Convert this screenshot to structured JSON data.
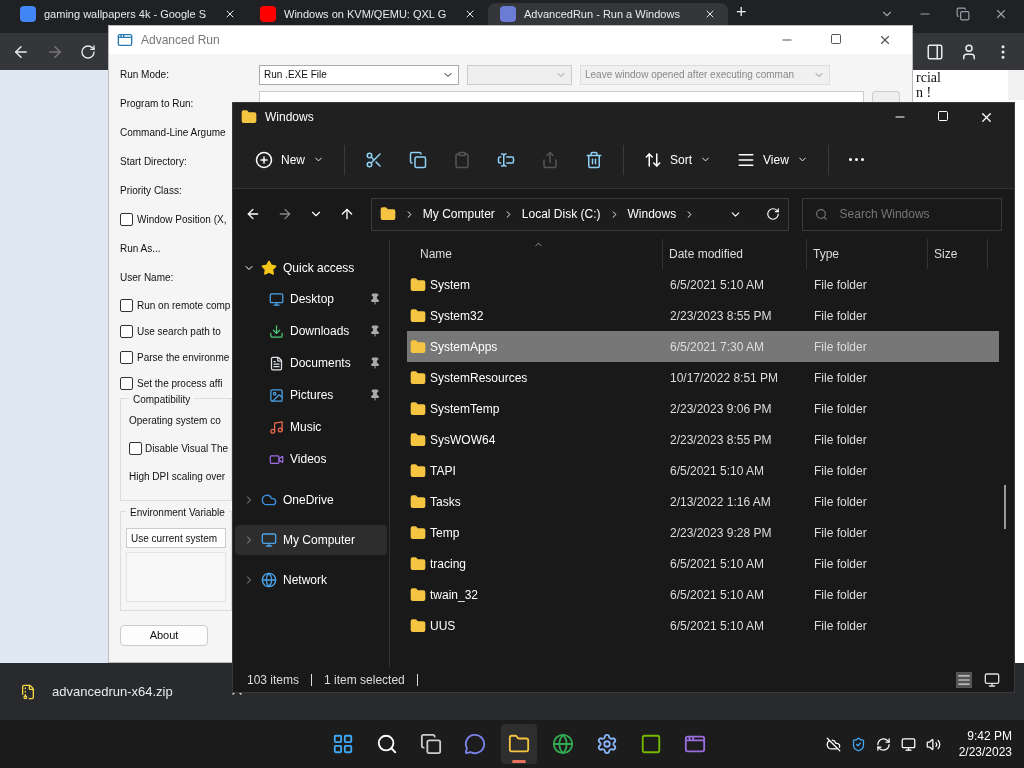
{
  "browser": {
    "tabs": [
      {
        "title": "gaming wallpapers 4k - Google S",
        "selected": false
      },
      {
        "title": "Windows on KVM/QEMU: QXL G",
        "selected": false
      },
      {
        "title": "AdvancedRun - Run a Windows",
        "selected": true
      }
    ],
    "new_tab": "+",
    "page_text": [
      "rcial",
      "n !"
    ]
  },
  "advanced_run": {
    "title": "Advanced Run",
    "run_mode": "Run .EXE File",
    "window_option": "Leave window opened after executing comman",
    "rows": [
      {
        "kind": "label",
        "text": "Run Mode:"
      },
      {
        "kind": "label",
        "text": "Program to Run:"
      },
      {
        "kind": "label",
        "text": "Command-Line Argume"
      },
      {
        "kind": "label",
        "text": "Start Directory:"
      },
      {
        "kind": "label",
        "text": "Priority Class:"
      },
      {
        "kind": "checkbox",
        "text": "Window Position (X,",
        "checked": false
      },
      {
        "kind": "label",
        "text": "Run As..."
      },
      {
        "kind": "label",
        "text": "User Name:"
      },
      {
        "kind": "checkbox",
        "text": "Run on remote comp",
        "checked": false
      },
      {
        "kind": "checkbox",
        "text": "Use search path to",
        "checked": false
      },
      {
        "kind": "checkbox",
        "text": "Parse the environme",
        "checked": false
      },
      {
        "kind": "checkbox",
        "text": "Set the process affi",
        "checked": false
      }
    ],
    "compatibility": {
      "title": "Compatibility",
      "os_label": "Operating system co",
      "checkbox": {
        "text": "Disable Visual The",
        "checked": false
      },
      "dpi_label": "High DPI scaling over"
    },
    "environment": {
      "title": "Environment Variable",
      "value": "Use current system"
    },
    "about_button": "About"
  },
  "downloads": {
    "file": "advancedrun-x64.zip"
  },
  "explorer": {
    "title": "Windows",
    "toolbar": [
      {
        "kind": "button",
        "label": "New",
        "caret": true,
        "disabled": false
      },
      {
        "kind": "separator"
      },
      {
        "kind": "button",
        "disabled": false
      },
      {
        "kind": "button",
        "disabled": false
      },
      {
        "kind": "button",
        "disabled": true
      },
      {
        "kind": "button",
        "disabled": false
      },
      {
        "kind": "button",
        "disabled": true
      },
      {
        "kind": "button",
        "disabled": false
      },
      {
        "kind": "separator"
      },
      {
        "kind": "button",
        "label": "Sort",
        "caret": true,
        "disabled": false
      },
      {
        "kind": "button",
        "label": "View",
        "caret": true,
        "disabled": false
      },
      {
        "kind": "separator"
      },
      {
        "kind": "button",
        "disabled": false
      }
    ],
    "breadcrumb": [
      "My Computer",
      "Local Disk (C:)",
      "Windows"
    ],
    "search_placeholder": "Search Windows",
    "nav": [
      {
        "label": "Quick access",
        "expanded": true,
        "selected": false,
        "children": [
          {
            "label": "Desktop",
            "pinned": true,
            "selected": false
          },
          {
            "label": "Downloads",
            "pinned": true,
            "selected": false
          },
          {
            "label": "Documents",
            "pinned": true,
            "selected": false
          },
          {
            "label": "Pictures",
            "pinned": true,
            "selected": false
          },
          {
            "label": "Music",
            "pinned": false,
            "selected": false
          },
          {
            "label": "Videos",
            "pinned": false,
            "selected": false
          }
        ]
      },
      {
        "label": "OneDrive",
        "expanded": false,
        "selected": false
      },
      {
        "label": "My Computer",
        "expanded": false,
        "selected": true
      },
      {
        "label": "Network",
        "expanded": false,
        "selected": false
      }
    ],
    "columns": [
      "Name",
      "Date modified",
      "Type",
      "Size"
    ],
    "rows": [
      {
        "name": "System",
        "date": "6/5/2021 5:10 AM",
        "type": "File folder",
        "selected": false
      },
      {
        "name": "System32",
        "date": "2/23/2023 8:55 PM",
        "type": "File folder",
        "selected": false
      },
      {
        "name": "SystemApps",
        "date": "6/5/2021 7:30 AM",
        "type": "File folder",
        "selected": true
      },
      {
        "name": "SystemResources",
        "date": "10/17/2022 8:51 PM",
        "type": "File folder",
        "selected": false
      },
      {
        "name": "SystemTemp",
        "date": "2/23/2023 9:06 PM",
        "type": "File folder",
        "selected": false
      },
      {
        "name": "SysWOW64",
        "date": "2/23/2023 8:55 PM",
        "type": "File folder",
        "selected": false
      },
      {
        "name": "TAPI",
        "date": "6/5/2021 5:10 AM",
        "type": "File folder",
        "selected": false
      },
      {
        "name": "Tasks",
        "date": "2/13/2022 1:16 AM",
        "type": "File folder",
        "selected": false
      },
      {
        "name": "Temp",
        "date": "2/23/2023 9:28 PM",
        "type": "File folder",
        "selected": false
      },
      {
        "name": "tracing",
        "date": "6/5/2021 5:10 AM",
        "type": "File folder",
        "selected": false
      },
      {
        "name": "twain_32",
        "date": "6/5/2021 5:10 AM",
        "type": "File folder",
        "selected": false
      },
      {
        "name": "UUS",
        "date": "6/5/2021 5:10 AM",
        "type": "File folder",
        "selected": false
      }
    ],
    "status": {
      "count": "103 items",
      "selection": "1 item selected"
    }
  },
  "taskbar": {
    "apps": [
      {
        "active": false
      },
      {
        "active": false
      },
      {
        "active": false
      },
      {
        "active": false
      },
      {
        "active": true
      },
      {
        "active": false
      },
      {
        "active": false
      },
      {
        "active": false
      },
      {
        "active": false
      }
    ],
    "time": "9:42 PM",
    "date": "2/23/2023"
  }
}
